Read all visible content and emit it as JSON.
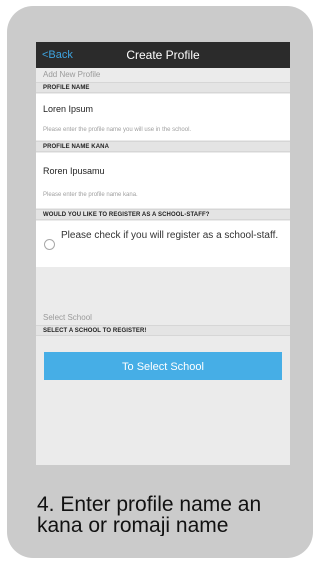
{
  "nav": {
    "back_label": "<Back",
    "title": "Create Profile"
  },
  "form": {
    "add_heading": "Add New Profile",
    "profile_name_label": "PROFILE NAME",
    "profile_name_value": "Loren Ipsum",
    "profile_name_hint": "Please enter the profile name you will use in the school.",
    "kana_label": "PROFILE NAME KANA",
    "kana_value": "Roren Ipusamu",
    "kana_hint": "Please enter the profile name kana.",
    "staff_label": "WOULD YOU LIKE TO REGISTER AS A SCHOOL-STAFF?",
    "staff_option": "Please check if you will register as a school-staff.",
    "school_heading": "Select School",
    "school_label": "SELECT A SCHOOL TO REGISTER!",
    "school_button": "To Select School"
  },
  "caption": {
    "line1": "4. Enter profile name an",
    "line2": "kana or romaji name"
  },
  "colors": {
    "accent": "#46aee6",
    "back_link": "#3ea3df",
    "navbar": "#2b2b2b",
    "card": "#cbcbcb"
  }
}
